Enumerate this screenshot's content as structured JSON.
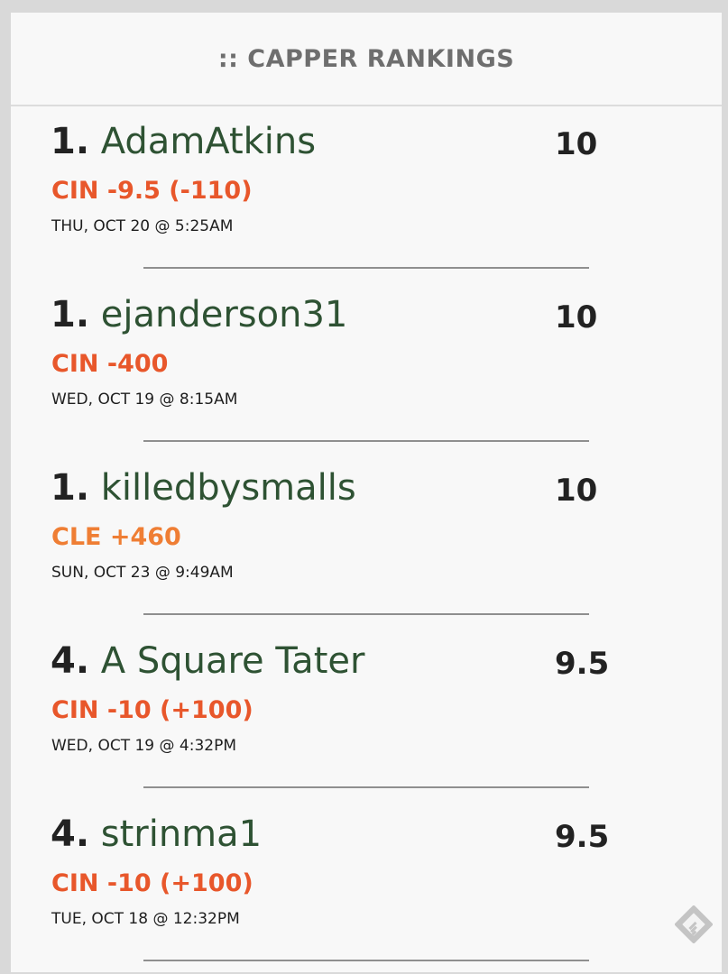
{
  "header": {
    "title": ":: CAPPER RANKINGS"
  },
  "rankings": [
    {
      "rank": "1.",
      "username": "AdamAtkins",
      "score": "10",
      "pick": "CIN -9.5 (-110)",
      "timestamp": "THU, OCT 20 @ 5:25AM"
    },
    {
      "rank": "1.",
      "username": "ejanderson31",
      "score": "10",
      "pick": "CIN -400",
      "timestamp": "WED, OCT 19 @ 8:15AM"
    },
    {
      "rank": "1.",
      "username": "killedbysmalls",
      "score": "10",
      "pick": "CLE +460",
      "timestamp": "SUN, OCT 23 @ 9:49AM"
    },
    {
      "rank": "4.",
      "username": "A Square Tater",
      "score": "9.5",
      "pick": "CIN -10 (+100)",
      "timestamp": "WED, OCT 19 @ 4:32PM"
    },
    {
      "rank": "4.",
      "username": "strinma1",
      "score": "9.5",
      "pick": "CIN -10 (+100)",
      "timestamp": "TUE, OCT 18 @ 12:32PM"
    }
  ],
  "colors": {
    "username": "#2e5233",
    "pick_cin": "#e8572b",
    "pick_cle": "#ef7e34",
    "rank": "#222222",
    "header_text": "#6e6e6e"
  },
  "icons": {
    "corner": "feedly-icon"
  }
}
